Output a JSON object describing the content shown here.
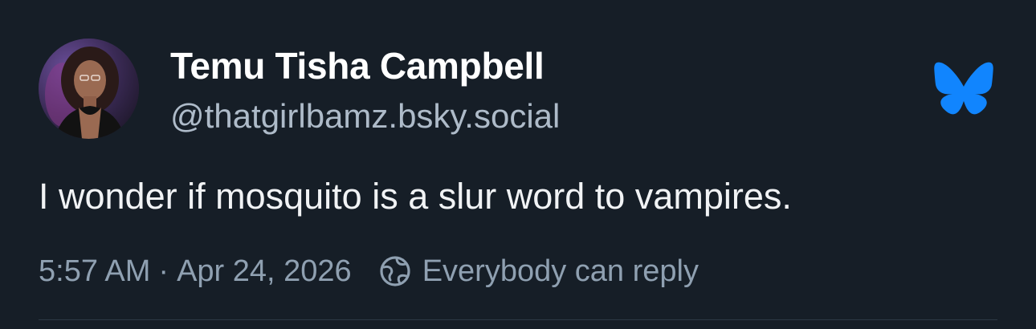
{
  "author": {
    "display_name": "Temu Tisha Campbell",
    "handle": "@thatgirlbamz.bsky.social",
    "avatar_icon": "user-avatar"
  },
  "post": {
    "text": "I wonder if mosquito is a slur word to vampires."
  },
  "meta": {
    "time": "5:57 AM",
    "separator": "·",
    "date": "Apr 24, 2026",
    "reply_setting": "Everybody can reply",
    "reply_icon": "globe-icon"
  },
  "brand": {
    "logo": "bluesky-butterfly-icon",
    "color": "#1185fe"
  },
  "colors": {
    "background": "#161e27",
    "primary_text": "#f1f3f5",
    "secondary_text": "#8fa0b1"
  }
}
